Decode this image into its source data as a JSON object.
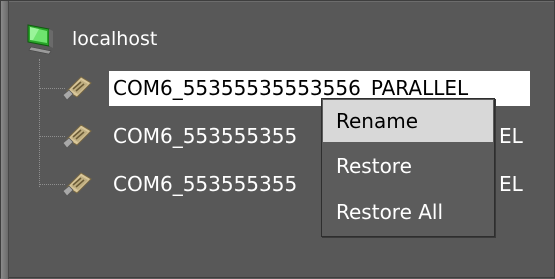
{
  "tree": {
    "root": {
      "label": "localhost",
      "icon": "monitor-icon"
    },
    "nodes": [
      {
        "label": "COM6_55355535553556_PARALLEL",
        "icon": "port-connector-icon",
        "selected": true
      },
      {
        "label": "COM6_553555355",
        "label_tail": "EL",
        "icon": "port-connector-icon",
        "selected": false
      },
      {
        "label": "COM6_553555355",
        "label_tail": "EL",
        "icon": "port-connector-icon",
        "selected": false
      }
    ]
  },
  "context_menu": {
    "items": [
      {
        "label": "Rename",
        "highlighted": true
      },
      {
        "label": "Restore",
        "highlighted": false
      },
      {
        "label": "Restore All",
        "highlighted": false
      }
    ]
  },
  "colors": {
    "panel_background": "#585858",
    "selection_background": "#ffffff",
    "menu_highlight": "#d8d8d8"
  }
}
